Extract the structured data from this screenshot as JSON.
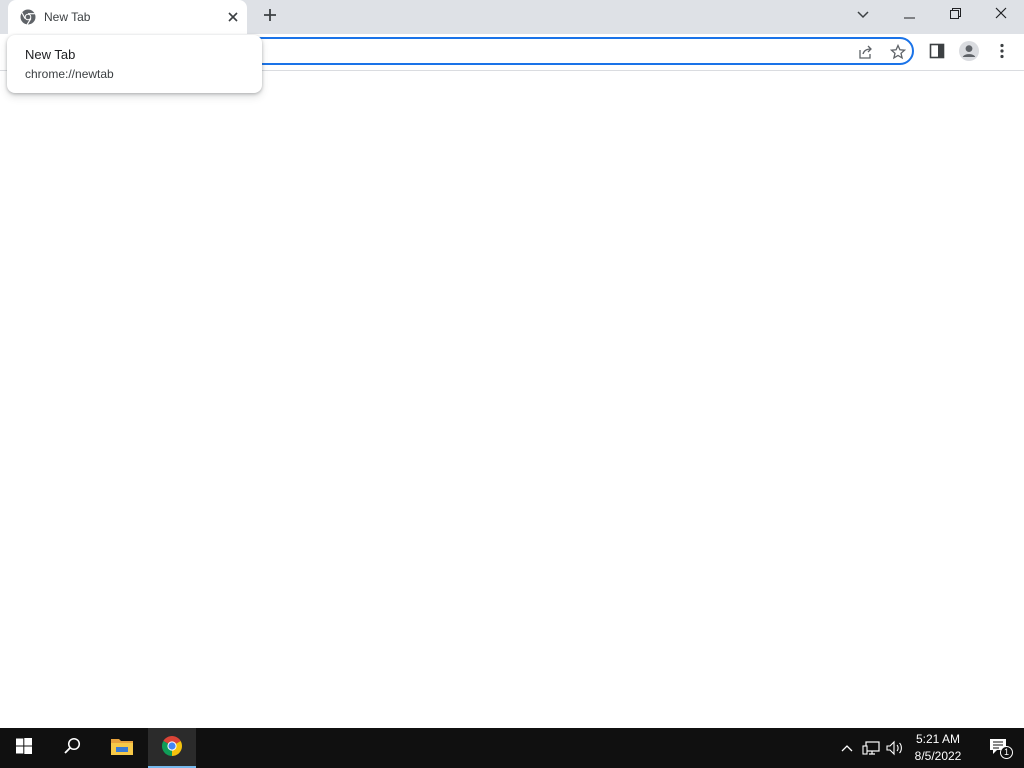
{
  "browser": {
    "tab": {
      "title": "New Tab",
      "favicon": "chrome-icon",
      "close_icon": "close-icon"
    },
    "new_tab_icon": "plus-icon",
    "tab_search_icon": "chevron-down-icon",
    "window_controls": [
      "minimize-icon",
      "restore-icon",
      "close-icon"
    ],
    "toolbar_icons": [
      "share-icon",
      "star-icon",
      "side-panel-icon",
      "profile-icon",
      "kebab-menu-icon"
    ],
    "hover_card": {
      "title": "New Tab",
      "url": "chrome://newtab"
    },
    "accent_color": "#1a73e8"
  },
  "taskbar": {
    "apps": [
      "windows-start-icon",
      "search-icon",
      "file-explorer-icon",
      "chrome-icon"
    ],
    "active_app": "chrome-icon",
    "tray_icons": [
      "chevron-up-icon",
      "network-icon",
      "volume-icon",
      "notification-icon"
    ],
    "clock": {
      "time": "5:21 AM",
      "date": "8/5/2022"
    },
    "notification_count": "1"
  }
}
